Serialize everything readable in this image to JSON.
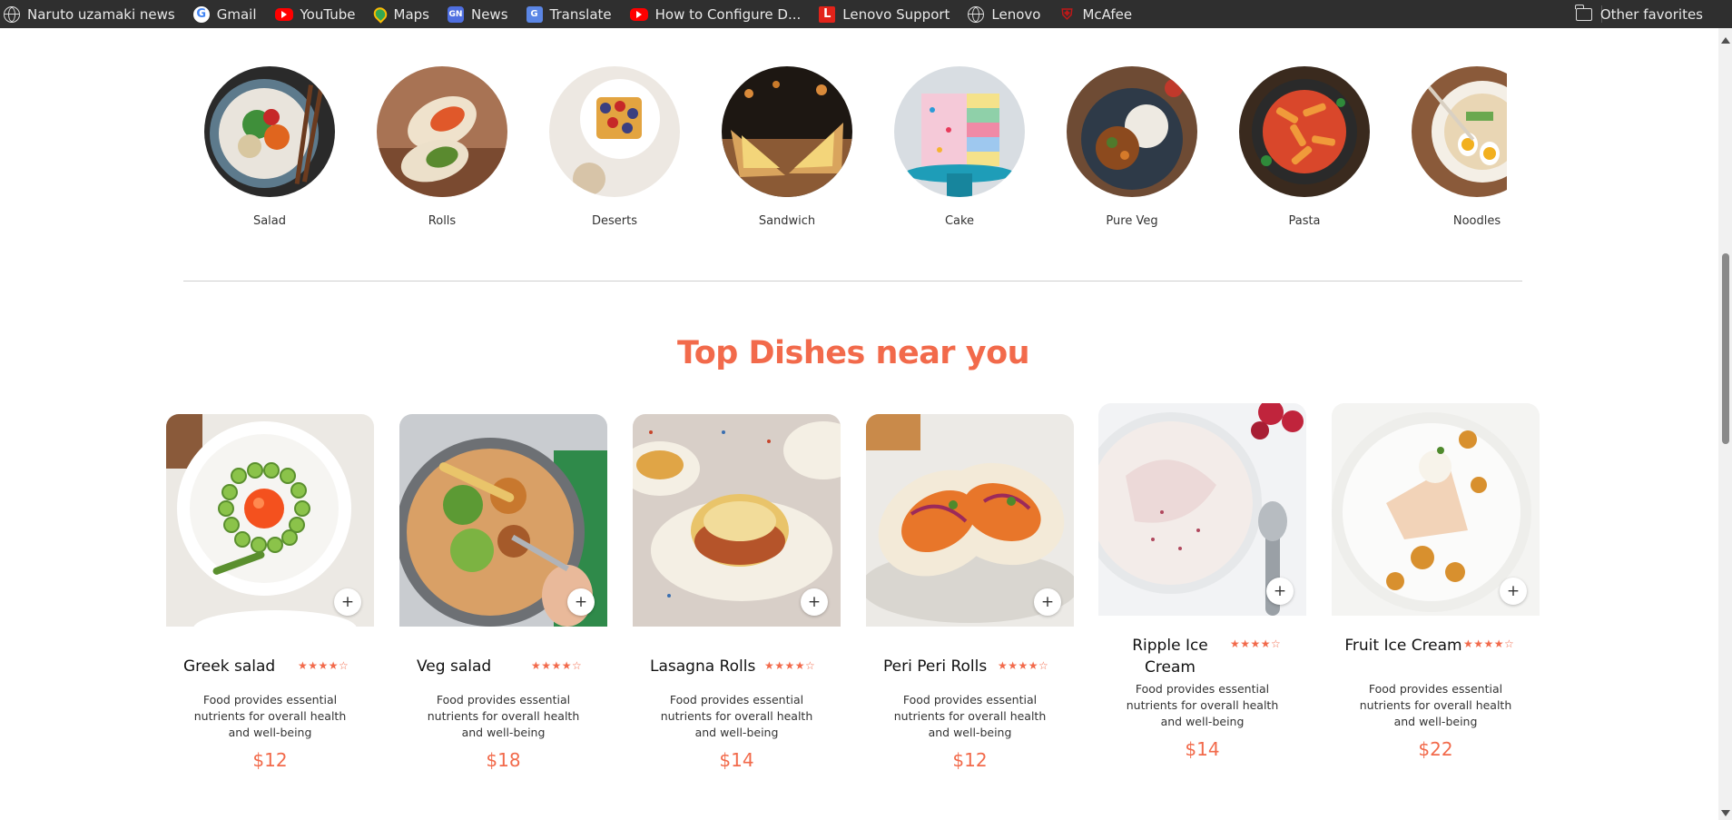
{
  "bookmarks": {
    "items": [
      {
        "label": "Naruto uzamaki news",
        "icon": "globe-icon"
      },
      {
        "label": "Gmail",
        "icon": "google-icon"
      },
      {
        "label": "YouTube",
        "icon": "youtube-icon"
      },
      {
        "label": "Maps",
        "icon": "maps-icon"
      },
      {
        "label": "News",
        "icon": "news-icon"
      },
      {
        "label": "Translate",
        "icon": "translate-icon"
      },
      {
        "label": "How to Configure D...",
        "icon": "youtube-icon"
      },
      {
        "label": "Lenovo Support",
        "icon": "lenovo-icon"
      },
      {
        "label": "Lenovo",
        "icon": "globe-icon"
      },
      {
        "label": "McAfee",
        "icon": "mcafee-icon"
      }
    ],
    "other_favorites": "Other favorites"
  },
  "menu": {
    "items": [
      {
        "label": "Salad"
      },
      {
        "label": "Rolls"
      },
      {
        "label": "Deserts"
      },
      {
        "label": "Sandwich"
      },
      {
        "label": "Cake"
      },
      {
        "label": "Pure Veg"
      },
      {
        "label": "Pasta"
      },
      {
        "label": "Noodles"
      }
    ]
  },
  "section": {
    "title": "Top Dishes near you"
  },
  "dishes": [
    {
      "name": "Greek salad",
      "stars": "★★★★☆",
      "description": "Food provides essential nutrients for overall health and well-being",
      "price": "$12",
      "add": "+"
    },
    {
      "name": "Veg salad",
      "stars": "★★★★☆",
      "description": "Food provides essential nutrients for overall health and well-being",
      "price": "$18",
      "add": "+"
    },
    {
      "name": "Lasagna Rolls",
      "stars": "★★★★☆",
      "description": "Food provides essential nutrients for overall health and well-being",
      "price": "$14",
      "add": "+"
    },
    {
      "name": "Peri Peri Rolls",
      "stars": "★★★★☆",
      "description": "Food provides essential nutrients for overall health and well-being",
      "price": "$12",
      "add": "+"
    },
    {
      "name": "Ripple Ice Cream",
      "stars": "★★★★☆",
      "description": "Food provides essential nutrients for overall health and well-being",
      "price": "$14",
      "add": "+"
    },
    {
      "name": "Fruit Ice Cream",
      "stars": "★★★★☆",
      "description": "Food provides essential nutrients for overall health and well-being",
      "price": "$22",
      "add": "+"
    }
  ],
  "colors": {
    "accent": "#f26a4b",
    "bookmark_bar": "#2f2f2f"
  }
}
